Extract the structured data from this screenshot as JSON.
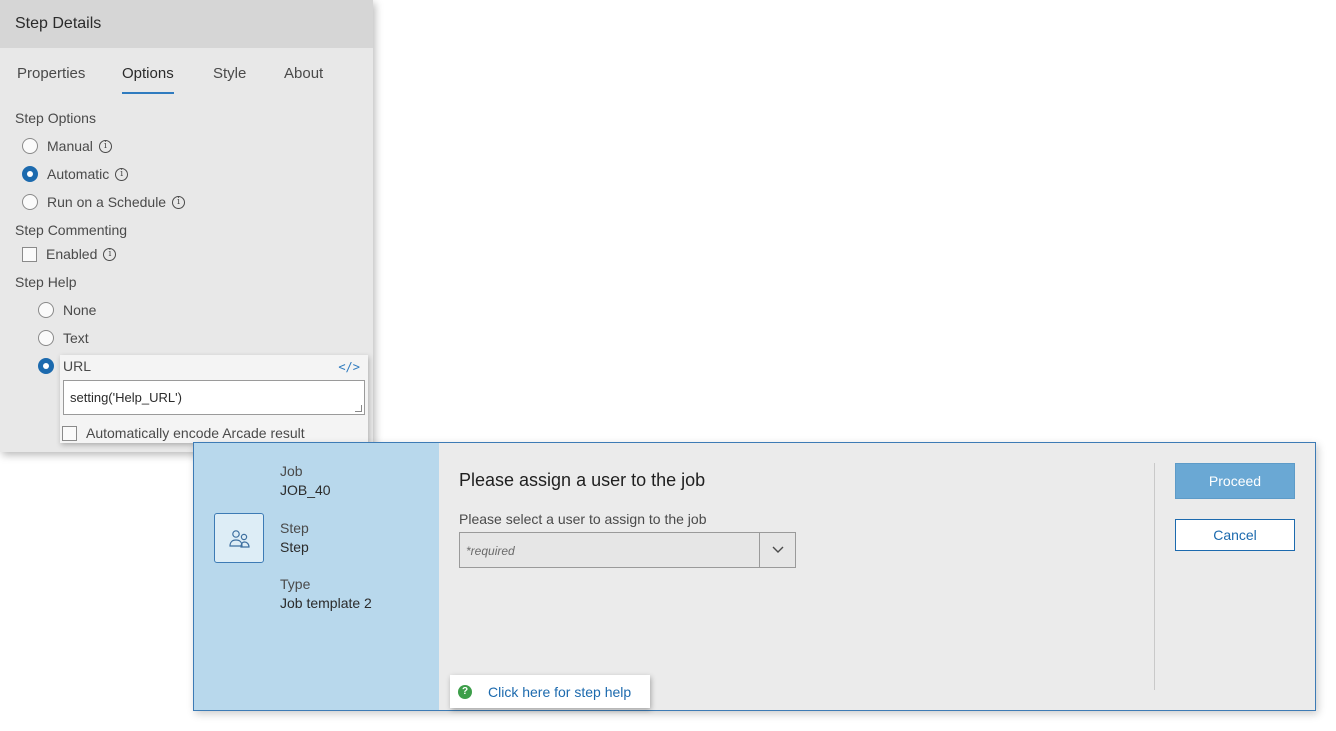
{
  "details": {
    "title": "Step Details",
    "tabs": [
      {
        "label": "Properties"
      },
      {
        "label": "Options"
      },
      {
        "label": "Style"
      },
      {
        "label": "About"
      }
    ],
    "step_options": {
      "label": "Step Options",
      "items": [
        {
          "label": "Manual",
          "checked": false
        },
        {
          "label": "Automatic",
          "checked": true
        },
        {
          "label": "Run on a Schedule",
          "checked": false
        }
      ]
    },
    "step_commenting": {
      "label": "Step Commenting",
      "enabled_label": "Enabled",
      "enabled": false
    },
    "step_help": {
      "label": "Step Help",
      "items": [
        {
          "label": "None",
          "checked": false
        },
        {
          "label": "Text",
          "checked": false
        },
        {
          "label": "URL",
          "checked": true
        }
      ],
      "url_value": "setting('Help_URL')",
      "encode_label": "Automatically encode Arcade result",
      "encode_checked": false
    }
  },
  "job": {
    "job_label": "Job",
    "job_value": "JOB_40",
    "step_label": "Step",
    "step_value": "Step",
    "type_label": "Type",
    "type_value": "Job template 2",
    "title": "Please assign a user to the job",
    "select_label": "Please select a user to assign to the job",
    "select_placeholder": "*required",
    "help_link": "Click here for step help",
    "proceed_label": "Proceed",
    "cancel_label": "Cancel"
  },
  "colors": {
    "accent": "#1c6aae",
    "job_sidebar": "#b8d8ec",
    "proceed": "#6aa8d4",
    "help_green": "#3d9e4a"
  }
}
